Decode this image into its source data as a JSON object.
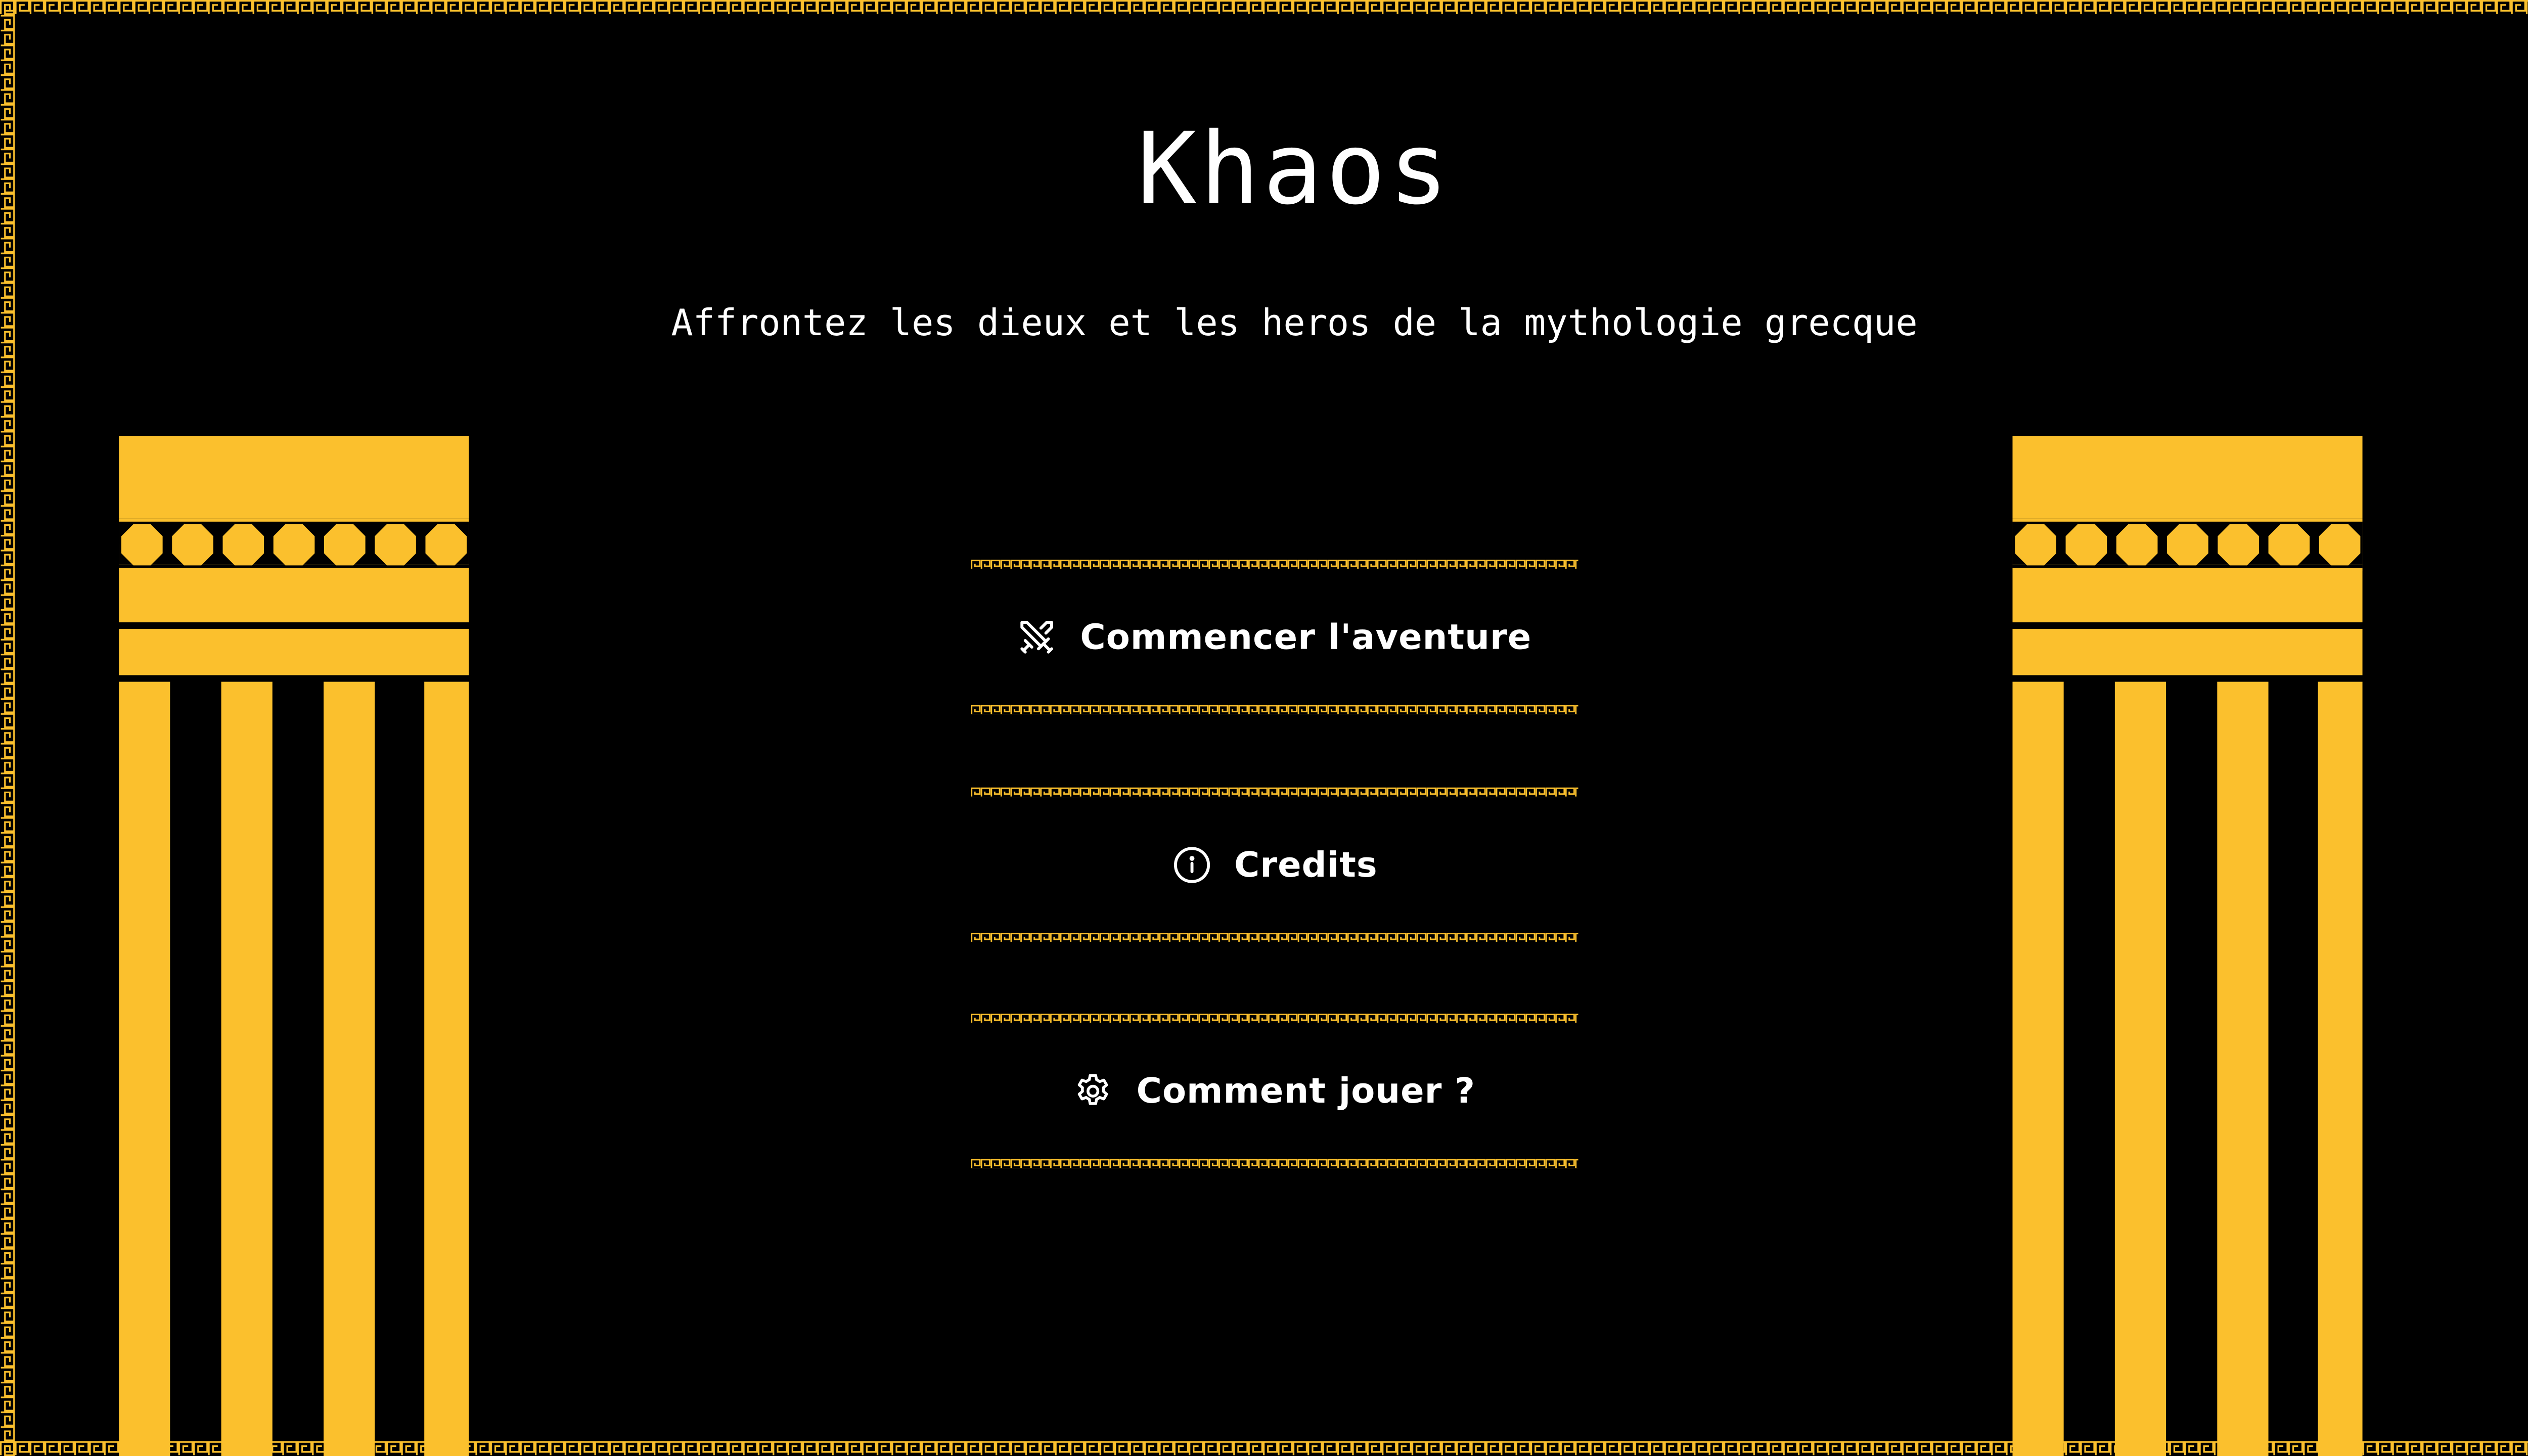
{
  "game": {
    "title": "Khaos",
    "subtitle": "Affrontez les dieux et les heros de la mythologie grecque"
  },
  "menu": {
    "items": [
      {
        "label": "Commencer l'aventure",
        "icon": "crossed-swords-icon"
      },
      {
        "label": "Credits",
        "icon": "info-icon"
      },
      {
        "label": "Comment jouer ?",
        "icon": "gear-icon"
      }
    ]
  },
  "theme": {
    "background": "#000000",
    "accent": "#FBC02D",
    "text": "#FFFFFF"
  }
}
